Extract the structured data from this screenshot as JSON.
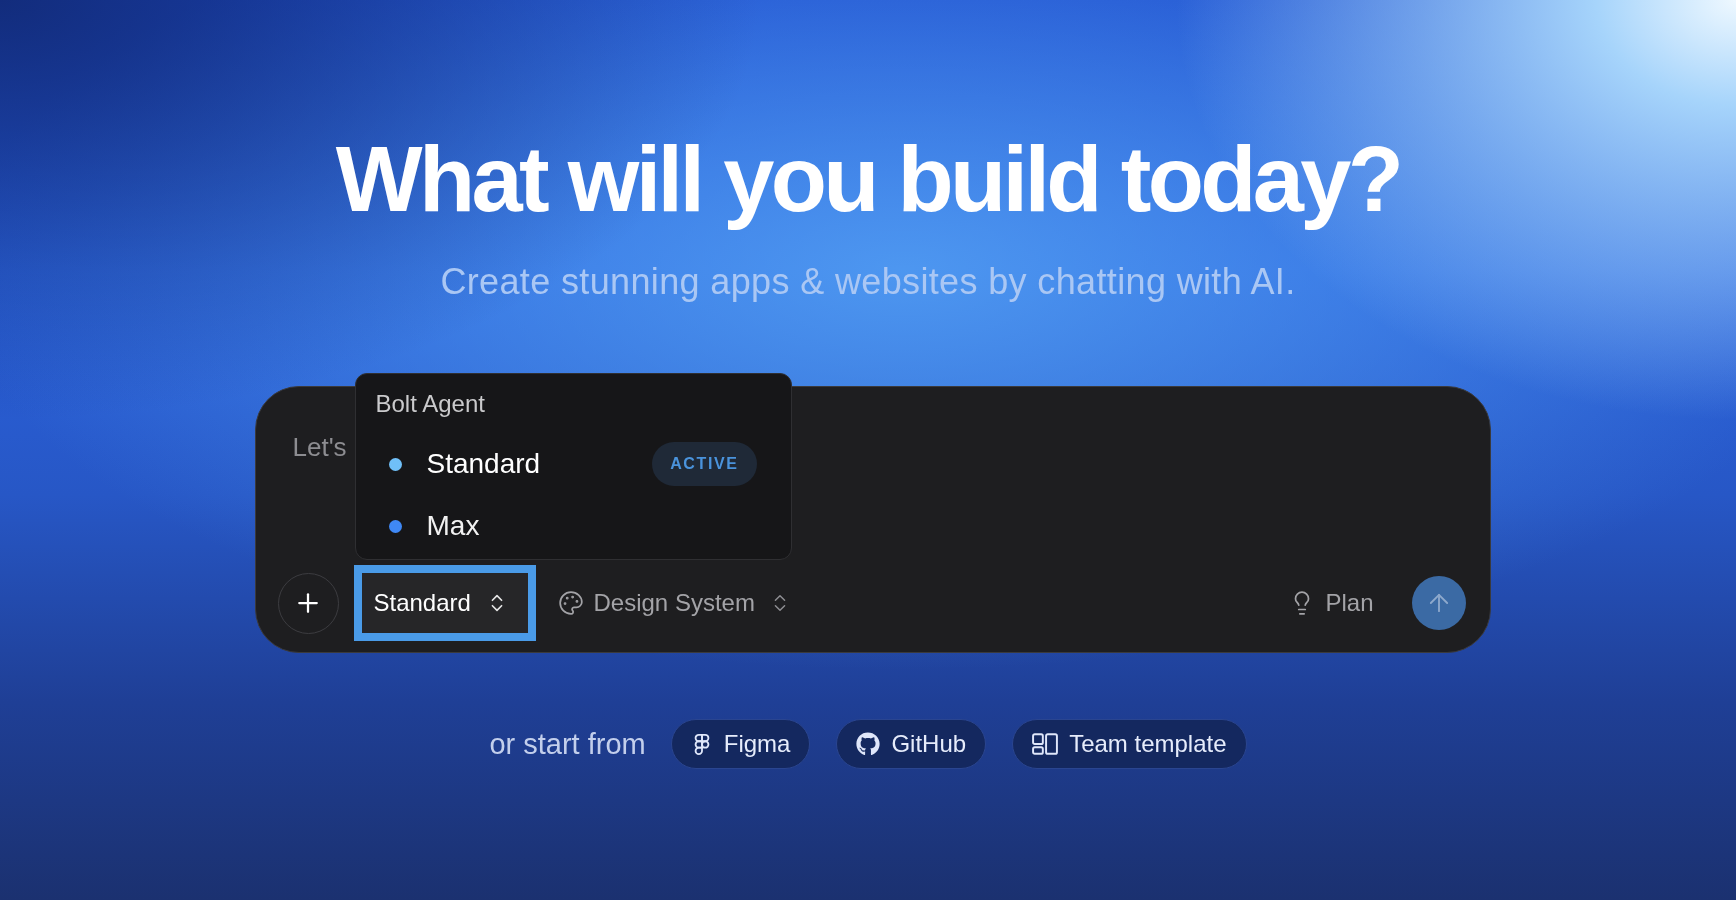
{
  "hero": {
    "title": "What will you build today?",
    "subtitle": "Create stunning apps & websites by chatting with AI."
  },
  "prompt": {
    "placeholder": "Let's",
    "toolbar": {
      "agent_select": {
        "value": "Standard",
        "highlighted": true
      },
      "design_system": {
        "label": "Design System"
      },
      "plan": {
        "label": "Plan"
      },
      "send": {
        "disabled": true
      }
    }
  },
  "agent_menu": {
    "heading": "Bolt Agent",
    "active_badge": "ACTIVE",
    "items": [
      {
        "label": "Standard",
        "color": "#70c0f8",
        "selected": true
      },
      {
        "label": "Max",
        "color": "#3f88f5",
        "selected": false
      }
    ]
  },
  "start": {
    "label": "or start from",
    "sources": [
      {
        "kind": "figma",
        "label": "Figma"
      },
      {
        "kind": "github",
        "label": "GitHub"
      },
      {
        "kind": "template",
        "label": "Team template"
      }
    ]
  }
}
